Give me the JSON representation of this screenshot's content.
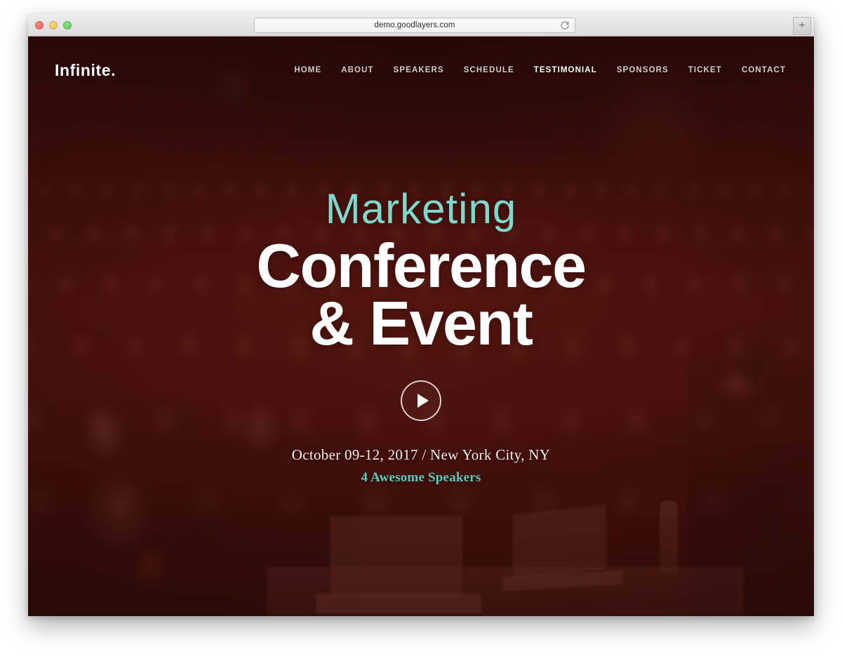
{
  "browser": {
    "url": "demo.goodlayers.com",
    "reload_icon": "reload-icon",
    "new_tab_label": "+",
    "traffic_lights": [
      {
        "name": "close",
        "color": "#ec5f56"
      },
      {
        "name": "minimize",
        "color": "#f4bd4f"
      },
      {
        "name": "zoom",
        "color": "#5bc94f"
      }
    ]
  },
  "site": {
    "logo": "Infinite.",
    "nav": [
      {
        "label": "HOME",
        "active": false
      },
      {
        "label": "ABOUT",
        "active": false
      },
      {
        "label": "SPEAKERS",
        "active": false
      },
      {
        "label": "SCHEDULE",
        "active": false
      },
      {
        "label": "TESTIMONIAL",
        "active": true
      },
      {
        "label": "SPONSORS",
        "active": false
      },
      {
        "label": "TICKET",
        "active": false
      },
      {
        "label": "CONTACT",
        "active": false
      }
    ],
    "hero": {
      "subtitle": "Marketing",
      "title_line1": "Conference",
      "title_line2": "& Event",
      "play_icon": "play-icon",
      "date_location": "October 09-12, 2017 / New York City, NY",
      "speakers_note": "4 Awesome Speakers"
    }
  },
  "colors": {
    "accent_teal": "#5fc9be",
    "subtitle_teal": "#7fd8cb",
    "overlay_maroon": "#691c16",
    "white": "#ffffff"
  }
}
